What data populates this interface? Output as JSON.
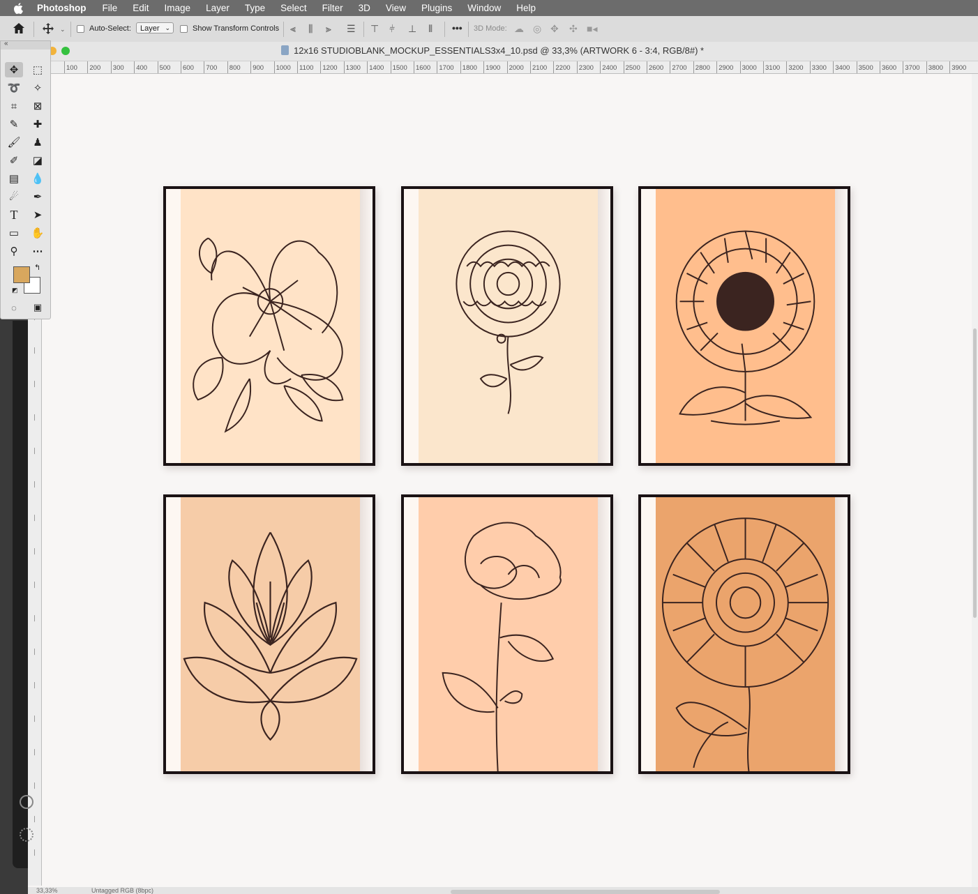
{
  "menubar": {
    "app_name": "Photoshop",
    "items": [
      "File",
      "Edit",
      "Image",
      "Layer",
      "Type",
      "Select",
      "Filter",
      "3D",
      "View",
      "Plugins",
      "Window",
      "Help"
    ]
  },
  "options_bar": {
    "auto_select_label": "Auto-Select:",
    "auto_select_checked": false,
    "auto_select_target": "Layer",
    "show_transform_label": "Show Transform Controls",
    "show_transform_checked": false,
    "more_label": "•••",
    "mode_3d_label": "3D Mode:"
  },
  "document": {
    "title": "12x16 STUDIOBLANK_MOCKUP_ESSENTIALS3x4_10.psd @ 33,3% (ARTWORK 6 - 3:4, RGB/8#) *"
  },
  "ruler": {
    "h_ticks": [
      "100",
      "200",
      "300",
      "400",
      "500",
      "600",
      "700",
      "800",
      "900",
      "1000",
      "1100",
      "1200",
      "1300",
      "1400",
      "1500",
      "1600",
      "1700",
      "1800",
      "1900",
      "2000",
      "2100",
      "2200",
      "2300",
      "2400",
      "2500",
      "2600",
      "2700",
      "2800",
      "2900",
      "3000",
      "3100",
      "3200",
      "3300",
      "3400",
      "3500",
      "3600",
      "3700",
      "3800",
      "3900"
    ]
  },
  "status": {
    "zoom": "33,33%",
    "profile": "Untagged RGB (8bpc)"
  },
  "artworks": [
    {
      "name": "rose",
      "bg": "#ffe3c7"
    },
    {
      "name": "carnation",
      "bg": "#fbe6cc"
    },
    {
      "name": "sunflower",
      "bg": "#ffbe8d"
    },
    {
      "name": "lotus",
      "bg": "#f6cca8"
    },
    {
      "name": "poppy",
      "bg": "#ffcdab"
    },
    {
      "name": "daisy",
      "bg": "#eba46c"
    }
  ],
  "colors": {
    "foreground": "#d8a75e",
    "background": "#ffffff",
    "ink": "#3b2420"
  }
}
